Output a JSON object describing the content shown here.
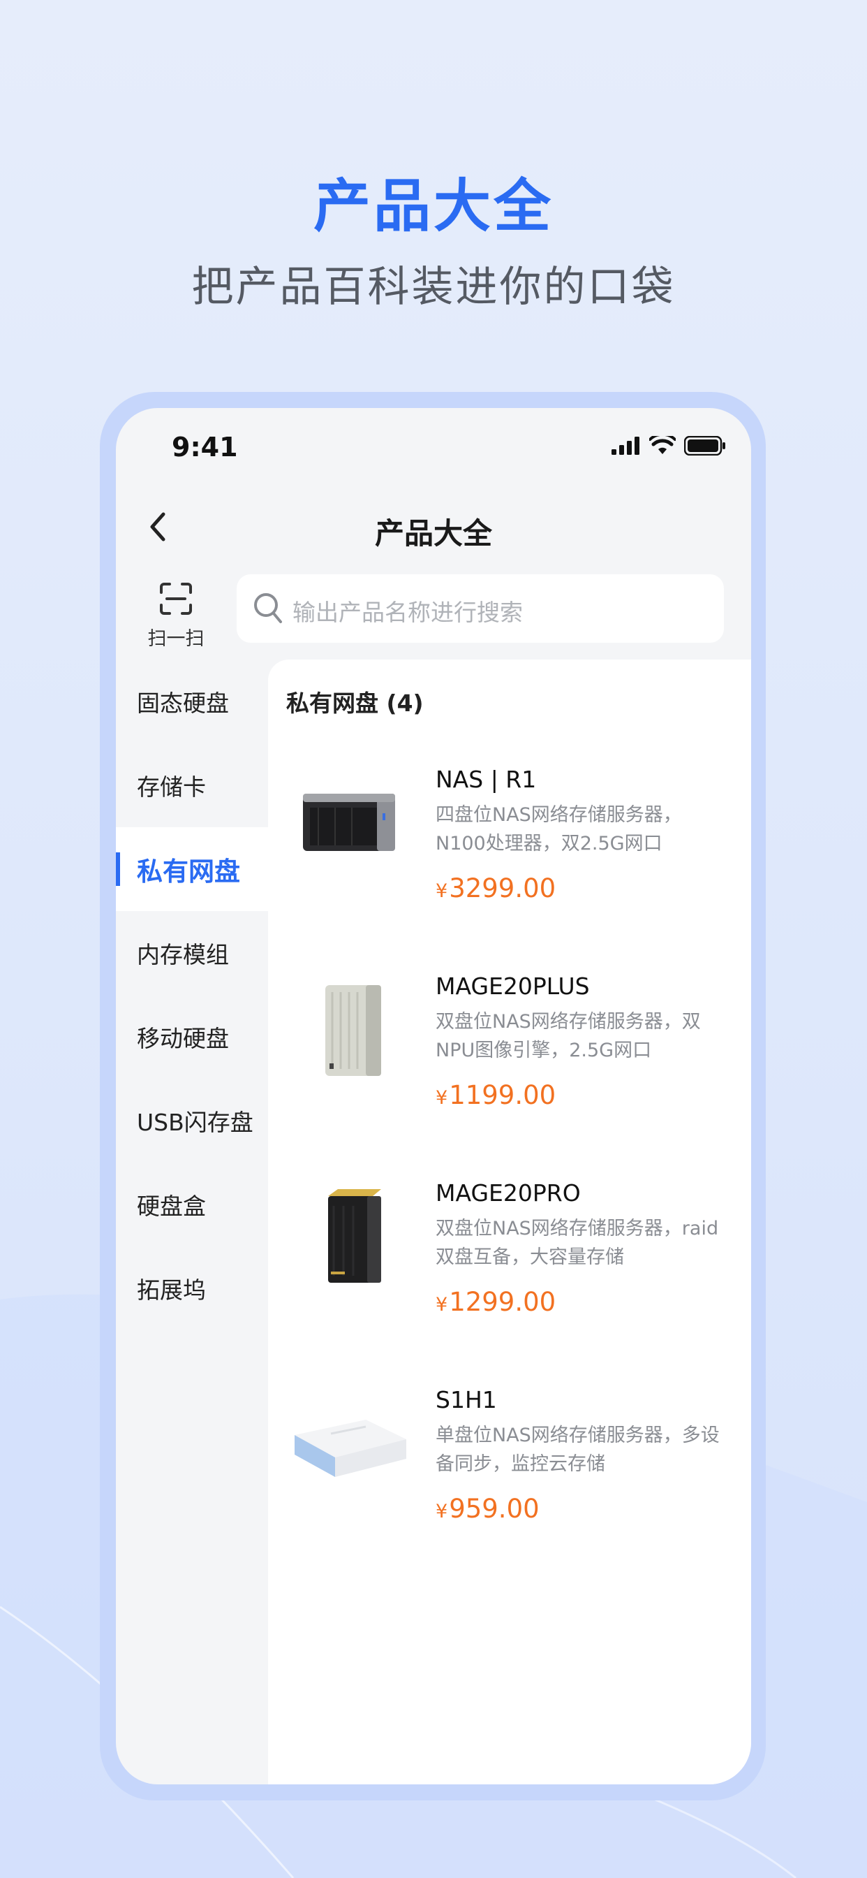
{
  "promo": {
    "title": "产品大全",
    "subtitle": "把产品百科装进你的口袋"
  },
  "status_bar": {
    "time": "9:41",
    "icons": [
      "signal-icon",
      "wifi-icon",
      "battery-icon"
    ]
  },
  "nav": {
    "title": "产品大全",
    "back_icon": "chevron-left-icon"
  },
  "scan": {
    "label": "扫一扫",
    "icon": "scan-icon"
  },
  "search": {
    "placeholder": "输出产品名称进行搜索",
    "icon": "search-icon"
  },
  "categories": [
    {
      "label": "固态硬盘",
      "active": false
    },
    {
      "label": "存储卡",
      "active": false
    },
    {
      "label": "私有网盘",
      "active": true
    },
    {
      "label": "内存模组",
      "active": false
    },
    {
      "label": "移动硬盘",
      "active": false
    },
    {
      "label": "USB闪存盘",
      "active": false
    },
    {
      "label": "硬盘盒",
      "active": false
    },
    {
      "label": "拓展坞",
      "active": false
    }
  ],
  "product_panel": {
    "heading": "私有网盘 (4)"
  },
  "products": [
    {
      "name": "NAS | R1",
      "desc": "四盘位NAS网络存储服务器，N100处理器，双2.5G网口",
      "currency": "¥",
      "price": "3299.00"
    },
    {
      "name": "MAGE20PLUS",
      "desc": "双盘位NAS网络存储服务器，双NPU图像引擎，2.5G网口",
      "currency": "¥",
      "price": "1199.00"
    },
    {
      "name": "MAGE20PRO",
      "desc": "双盘位NAS网络存储服务器，raid双盘互备，大容量存储",
      "currency": "¥",
      "price": "1299.00"
    },
    {
      "name": "S1H1",
      "desc": "单盘位NAS网络存储服务器，多设备同步，监控云存储",
      "currency": "¥",
      "price": "959.00"
    }
  ],
  "colors": {
    "accent": "#2a6bf2",
    "price": "#f27121",
    "background": "#e6edfb",
    "frame": "#c6d6fb"
  }
}
